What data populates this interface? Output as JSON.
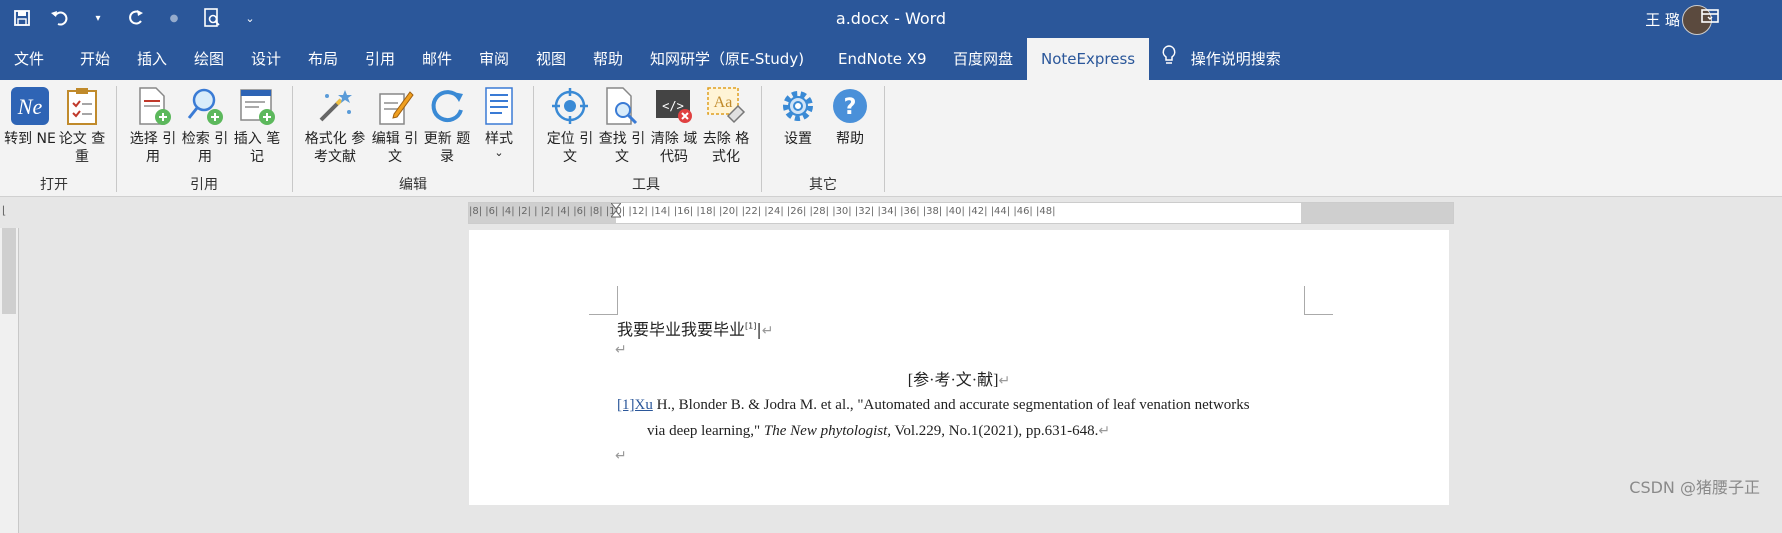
{
  "window": {
    "title": "a.docx  -  Word",
    "user": "王 璐"
  },
  "tabs": [
    "文件",
    "开始",
    "插入",
    "绘图",
    "设计",
    "布局",
    "引用",
    "邮件",
    "审阅",
    "视图",
    "帮助",
    "知网研学（原E-Study)",
    "EndNote X9",
    "百度网盘",
    "NoteExpress"
  ],
  "search_label": "操作说明搜索",
  "ribbon": {
    "buttons": {
      "goto_ne": "转到 NE",
      "thesis_check": "论文 查重",
      "select_cite": "选择 引用",
      "search_cite": "检索 引用",
      "insert_note": "插入 笔记",
      "format_refs": "格式化 参考文献",
      "edit_cite": "编辑 引文",
      "update_list": "更新 题录",
      "style": "样式",
      "style_arrow": "⌄",
      "locate_cite": "定位 引文",
      "find_cite": "查找 引文",
      "clear_fields": "清除 域代码",
      "unformat": "去除 格式化",
      "settings": "设置",
      "help": "帮助"
    },
    "groups": {
      "open": "打开",
      "cite": "引用",
      "edit": "编辑",
      "tools": "工具",
      "other": "其它"
    }
  },
  "ruler": {
    "ticks": "|8| |6| |4| |2| | |2| |4| |6| |8| |10| |12| |14| |16| |18| |20| |22| |24| |26| |28| |30| |32| |34| |36| |38| |40| |42| |44| |46| |48|"
  },
  "document": {
    "line1": "我要毕业我要毕业",
    "line1_sup": "[1]",
    "para_mark": "↵",
    "ref_heading": "[参·考·文·献]",
    "ref1_index": "[1]Xu",
    "ref1_line1": " H., Blonder B. & Jodra M. et al., \"Automated and accurate segmentation of leaf venation networks",
    "ref1_line2_a": "via deep learning,\" ",
    "ref1_journal": "The New phytologist,",
    "ref1_line2_b": " Vol.229, No.1(2021), pp.631-648."
  },
  "watermark": "CSDN @猪腰子正"
}
